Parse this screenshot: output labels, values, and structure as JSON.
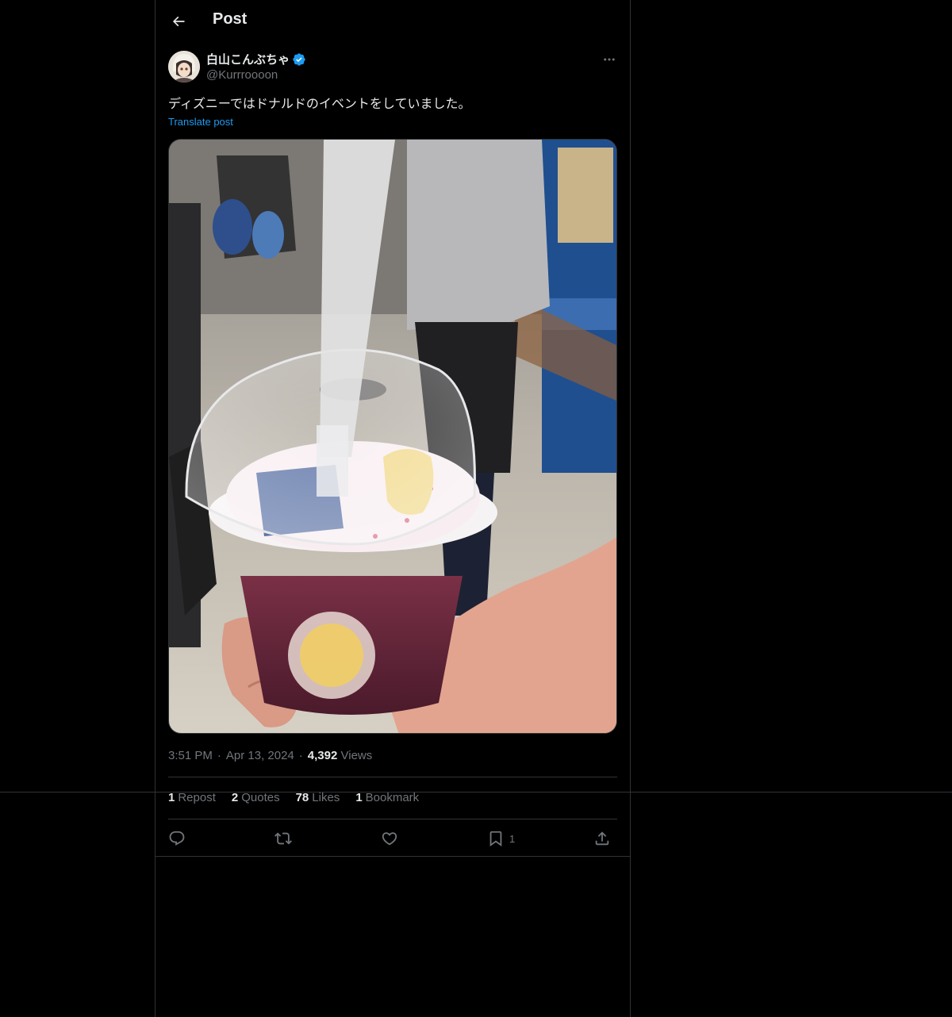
{
  "header": {
    "title": "Post",
    "back_icon": "arrow-left-icon"
  },
  "author": {
    "display_name": "白山こんぶちゃ",
    "handle": "@Kurrroooon",
    "verified": true,
    "verified_color": "#1d9bf0"
  },
  "post": {
    "text": "ディズニーではドナルドのイベントをしていました。",
    "translate_label": "Translate post",
    "time": "3:51 PM",
    "date": "Apr 13, 2024",
    "views_count": "4,392",
    "views_label": "Views"
  },
  "stats": {
    "reposts_count": "1",
    "reposts_label": "Repost",
    "quotes_count": "2",
    "quotes_label": "Quotes",
    "likes_count": "78",
    "likes_label": "Likes",
    "bookmarks_count": "1",
    "bookmarks_label": "Bookmark"
  },
  "actions": {
    "reply_icon": "reply-icon",
    "repost_icon": "repost-icon",
    "like_icon": "heart-icon",
    "bookmark_icon": "bookmark-icon",
    "bookmark_count": "1",
    "share_icon": "share-icon"
  },
  "colors": {
    "background": "#000000",
    "text_primary": "#e7e9ea",
    "text_secondary": "#71767b",
    "accent": "#1d9bf0",
    "border": "#2f3336"
  }
}
